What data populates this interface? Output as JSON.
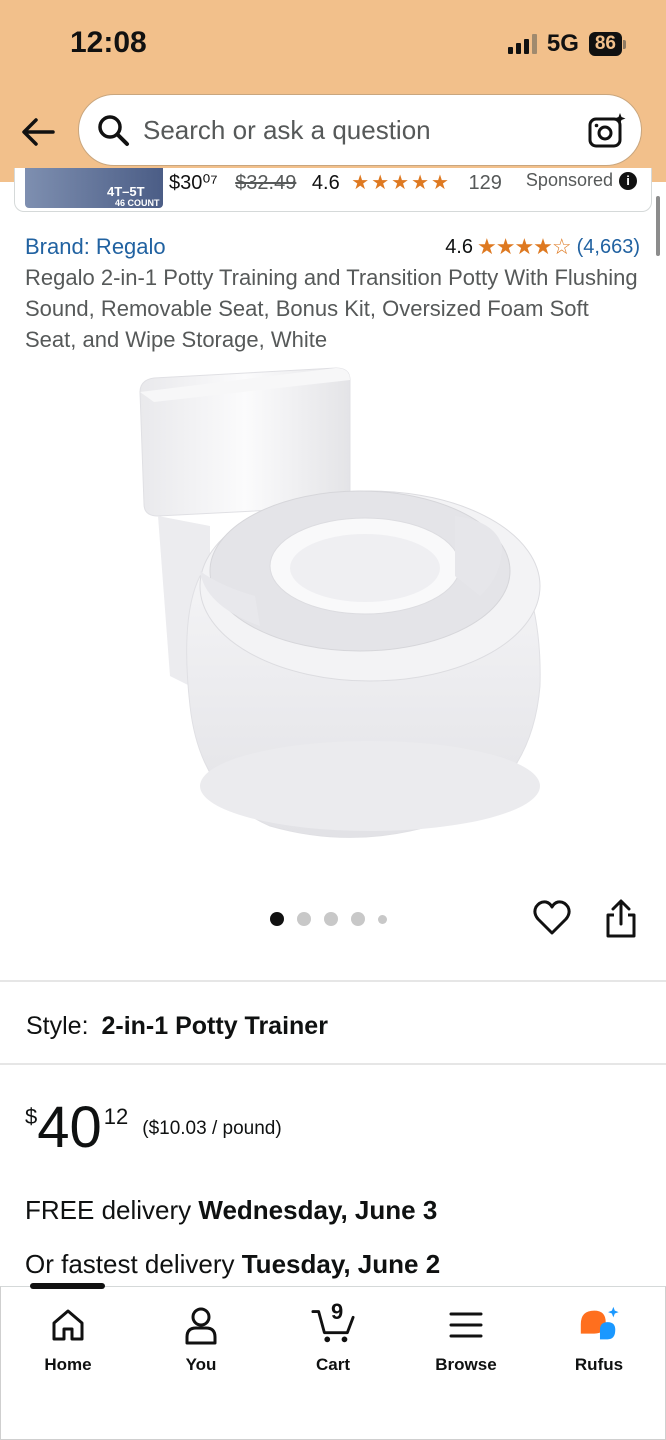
{
  "status_bar": {
    "time": "12:08",
    "network": "5G",
    "battery": "86"
  },
  "search": {
    "placeholder": "Search or ask a question"
  },
  "sponsored_strip": {
    "thumb_label": "4T–5T",
    "thumb_count": "46 COUNT",
    "price": "$30⁰⁷",
    "list_price": "$32.49",
    "rating": "4.6",
    "stars": "★★★★★",
    "review_count": "129",
    "label": "Sponsored",
    "info": "i"
  },
  "product": {
    "brand": "Brand: Regalo",
    "rating": "4.6",
    "rating_stars": "★★★★☆",
    "rating_count": "(4,663)",
    "title": "Regalo 2-in-1 Potty Training and Transition Potty With Flushing Sound, Removable Seat, Bonus Kit, Oversized Foam Soft Seat, and Wipe Storage, White",
    "image_count": 5,
    "active_image": 1
  },
  "style": {
    "label": "Style:",
    "value": "2-in-1 Potty Trainer"
  },
  "price": {
    "symbol": "$",
    "whole": "40",
    "fraction": "12",
    "unit_price": "($10.03 / pound)"
  },
  "delivery": {
    "free_prefix": "FREE delivery ",
    "free_date": "Wednesday, June 3",
    "fast_prefix": "Or fastest delivery ",
    "fast_date": "Tuesday, June 2"
  },
  "tabbar": {
    "items": [
      {
        "label": "Home",
        "icon": "home-icon"
      },
      {
        "label": "You",
        "icon": "person-icon"
      },
      {
        "label": "Cart",
        "icon": "cart-icon"
      },
      {
        "label": "Browse",
        "icon": "menu-icon"
      },
      {
        "label": "Rufus",
        "icon": "rufus-icon"
      }
    ],
    "cart_count": "9",
    "active_index": 0
  },
  "colors": {
    "header_bg": "#f2c08b",
    "link": "#2162a1",
    "star": "#de7921",
    "rufus_orange": "#ff6f1e",
    "rufus_blue": "#1a98ff"
  }
}
